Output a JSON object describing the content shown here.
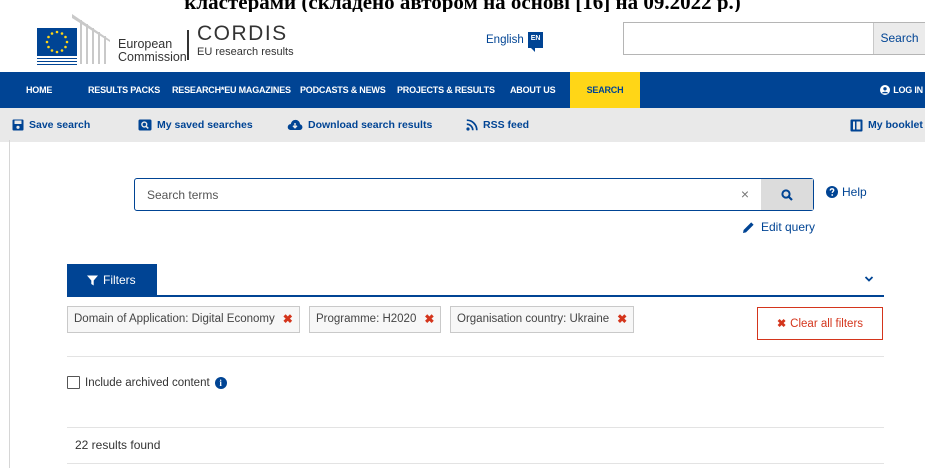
{
  "caption": "кластерами (складено автором на основі [16] на 09.2022 р.)",
  "header": {
    "ec_line1": "European",
    "ec_line2": "Commission",
    "cordis_name": "CORDIS",
    "cordis_sub": "EU research results",
    "language": "English",
    "language_code": "EN",
    "search_button": "Search",
    "search_value": ""
  },
  "nav": {
    "items": [
      "HOME",
      "RESULTS PACKS",
      "RESEARCH*EU MAGAZINES",
      "PODCASTS & NEWS",
      "PROJECTS & RESULTS",
      "ABOUT US"
    ],
    "active": "SEARCH",
    "login": "LOG IN"
  },
  "toolbar": {
    "save_search": "Save search",
    "my_saved_searches": "My saved searches",
    "download": "Download search results",
    "rss": "RSS feed",
    "booklet": "My booklet"
  },
  "search": {
    "placeholder": "Search terms",
    "value": "",
    "clear_icon": "×",
    "help": "Help",
    "edit_query": "Edit query"
  },
  "filters": {
    "tab_label": "Filters",
    "chips": [
      {
        "label": "Domain of Application: Digital Economy"
      },
      {
        "label": "Programme: H2020"
      },
      {
        "label": "Organisation country: Ukraine"
      }
    ],
    "clear_all": "Clear all filters"
  },
  "archived": {
    "label": "Include archived content",
    "checked": false
  },
  "results": {
    "count_text": "22 results found"
  },
  "colors": {
    "brand_blue": "#004494",
    "search_yellow": "#ffd617",
    "danger_red": "#d4351c",
    "toolbar_grey": "#e9e9e9"
  },
  "icons": [
    "eu-flag-icon",
    "save-icon",
    "saved-searches-icon",
    "cloud-download-icon",
    "rss-icon",
    "booklet-icon",
    "user-icon",
    "search-icon",
    "help-icon",
    "pencil-icon",
    "filter-icon",
    "chevron-down-icon",
    "close-icon",
    "info-icon"
  ]
}
